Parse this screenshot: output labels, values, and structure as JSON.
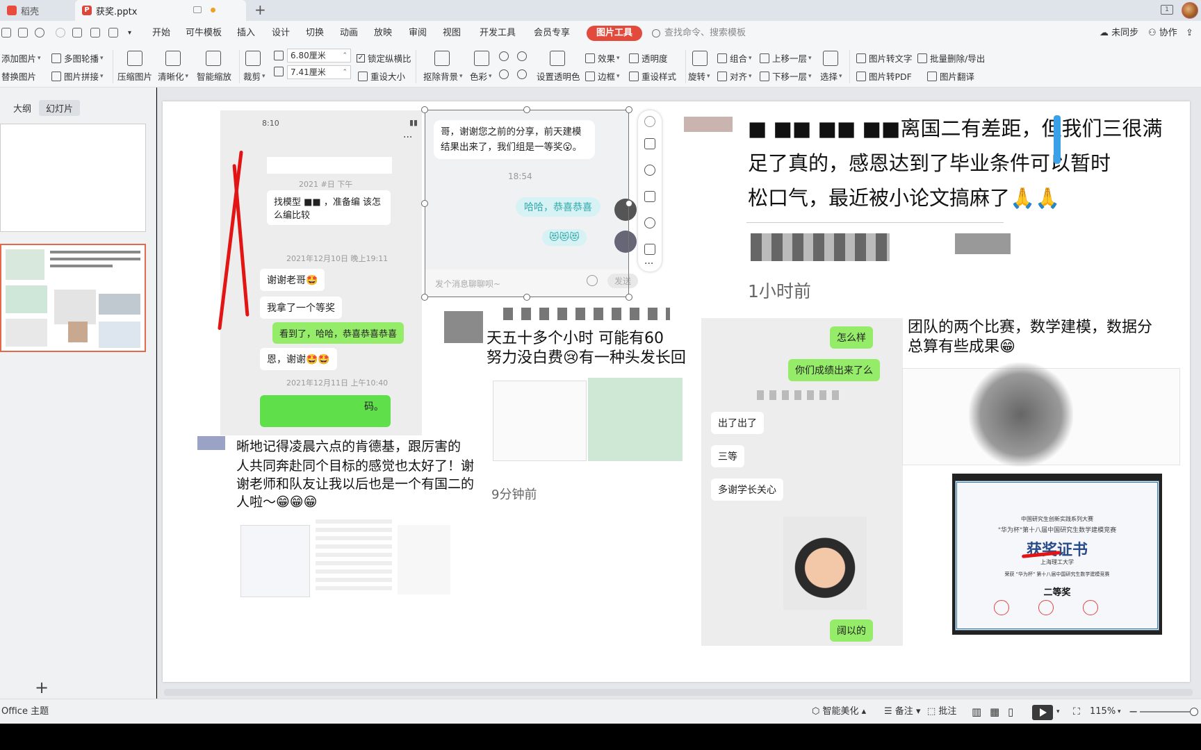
{
  "titlebar": {
    "home_tab": "稻壳",
    "file_tab": "获奖.pptx",
    "window_btn": "1"
  },
  "menubar": {
    "items": [
      "开始",
      "可牛模板",
      "插入",
      "设计",
      "切换",
      "动画",
      "放映",
      "审阅",
      "视图",
      "开发工具",
      "会员专享"
    ],
    "active_tool": "图片工具",
    "search_placeholder": "查找命令、搜索模板",
    "sync": "未同步",
    "collab": "协作"
  },
  "ribbon": {
    "add_image": "添加图片",
    "multi_carousel": "多图轮播",
    "replace_image": "替换图片",
    "image_splice": "图片拼接",
    "compress": "压缩图片",
    "sharpen": "清晰化",
    "smart_scale": "智能缩放",
    "crop": "裁剪",
    "width_value": "6.80厘米",
    "height_value": "7.41厘米",
    "lock_ratio": "锁定纵横比",
    "reset_size": "重设大小",
    "remove_bg": "抠除背景",
    "color": "色彩",
    "set_transparent": "设置透明色",
    "effects": "效果",
    "transparency": "透明度",
    "border": "边框",
    "reset_style": "重设样式",
    "rotate": "旋转",
    "group": "组合",
    "align": "对齐",
    "bring_forward": "上移一层",
    "send_backward": "下移一层",
    "select": "选择",
    "img_to_text": "图片转文字",
    "img_to_pdf": "图片转PDF",
    "batch_delete": "批量删除/导出",
    "img_translate": "图片翻译"
  },
  "leftpane": {
    "outline_tab": "大纲",
    "slides_tab": "幻灯片",
    "add_label": "+"
  },
  "slide": {
    "chat1": {
      "status_time": "8:10",
      "ts_partial": "2021",
      "ts_mid": "#日 下午",
      "msg_partial_1": "找模型",
      "msg_partial_1b": "，准备编",
      "msg_partial_2": "该怎么编比较",
      "ts2": "2021年12月10日 晚上19:11",
      "msg_thanks": "谢谢老哥🤩",
      "msg_got": "我拿了一个等奖",
      "msg_congrats": "看到了，哈哈，恭喜恭喜恭喜",
      "msg_thanks2": "恩，谢谢🤩🤩",
      "ts3": "2021年12月11日 上午10:40",
      "msg_green_partial": "码。"
    },
    "chat2": {
      "msg_top": "哥，谢谢您之前的分享，前天建模结果出来了，我们组是一等奖😮。",
      "time": "18:54",
      "msg_haha": "哈哈，恭喜恭喜",
      "msg_emoji": "😻😻😻",
      "input_placeholder": "发个消息聊聊呗~",
      "send": "发送"
    },
    "post_top": {
      "line1": "离国二有差距，但我们三很满",
      "line2": "足了真的，感恩达到了毕业条件可以暂时",
      "line3": "松口气，最近被小论文搞麻了🙏🙏",
      "time": "1小时前"
    },
    "post_mid": {
      "line1": "天五十多个小时 可能有60",
      "line2": "努力没白费😢有一种头发长回",
      "time": "9分钟前"
    },
    "post_bottom": {
      "line1": "晰地记得凌晨六点的肯德基，跟厉害的",
      "line2": "人共同奔赴同个目标的感觉也太好了！谢",
      "line3": "谢老师和队友让我以后也是一个有国二的",
      "line4": "人啦～😁😁😁"
    },
    "chat3": {
      "q1": "怎么样",
      "q2": "你们成绩出来了么",
      "a1": "出了出了",
      "a2": "三等",
      "a3": "多谢学长关心",
      "end": "阔以的"
    },
    "post_right": {
      "line1": "团队的两个比赛，数学建模，数据分",
      "line2": "总算有些成果😁"
    },
    "certificate": {
      "org": "中国研究生创新实践系列大赛",
      "contest": "\"华为杯\"第十八届中国研究生数学建模竞赛",
      "title": "获奖证书",
      "school": "上海理工大学",
      "award_line": "荣获 \"华为杯\" 第十八届中国研究生数学建模竞赛",
      "level": "二等奖"
    }
  },
  "statusbar": {
    "theme": "Office 主题",
    "beautify": "智能美化",
    "notes": "备注",
    "comments": "批注",
    "zoom": "115%"
  }
}
